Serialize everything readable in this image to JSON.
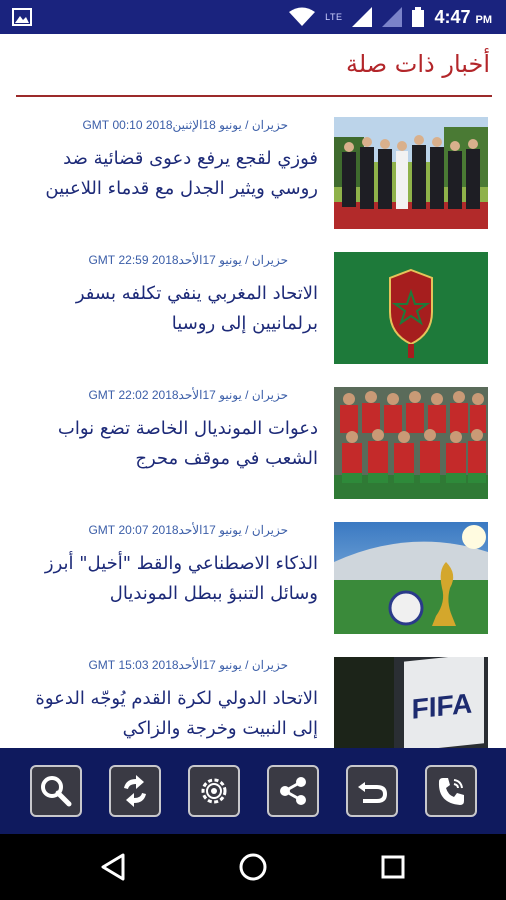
{
  "status_bar": {
    "time": "4:47",
    "ampm": "PM",
    "network": "LTE"
  },
  "section": {
    "title": "أخبار ذات صلة"
  },
  "news": [
    {
      "date": "حزيران / يونيو 18الإثنين2018 00:10 GMT",
      "headline": "فوزي لقجع  يرفع دعوى قضائية ضد روسي ويثير الجدل مع قدماء اللاعبين",
      "image": "officials-walking-photo"
    },
    {
      "date": "حزيران / يونيو 17الأحد2018 22:59 GMT",
      "headline": "الاتحاد المغربي ينفي تكلفه بسفر برلمانيين إلى روسيا",
      "image": "morocco-federation-logo"
    },
    {
      "date": "حزيران / يونيو 17الأحد2018 22:02 GMT",
      "headline": "دعوات المونديال الخاصة تضع نواب الشعب في موقف محرج",
      "image": "team-photo"
    },
    {
      "date": "حزيران / يونيو 17الأحد2018 20:07 GMT",
      "headline": "الذكاء الاصطناعي والقط \"أخيل\" أبرز وسائل التنبؤ ببطل المونديال",
      "image": "world-cup-trophy-photo"
    },
    {
      "date": "حزيران / يونيو 17الأحد2018 15:03 GMT",
      "headline": "الاتحاد الدولي لكرة القدم يُوجّه الدعوة إلى النبيت وخرجة والزاكي",
      "image": "fifa-sign-photo"
    }
  ],
  "toolbar": [
    {
      "name": "search-button",
      "icon": "search-icon"
    },
    {
      "name": "refresh-button",
      "icon": "refresh-icon"
    },
    {
      "name": "settings-button",
      "icon": "gear-icon"
    },
    {
      "name": "share-button",
      "icon": "share-icon"
    },
    {
      "name": "back-button",
      "icon": "undo-icon"
    },
    {
      "name": "call-button",
      "icon": "phone-icon"
    }
  ],
  "colors": {
    "status_bar": "#1a237e",
    "title": "#b3262a",
    "headline": "#1d2a78",
    "toolbar": "#0f1a5e"
  }
}
